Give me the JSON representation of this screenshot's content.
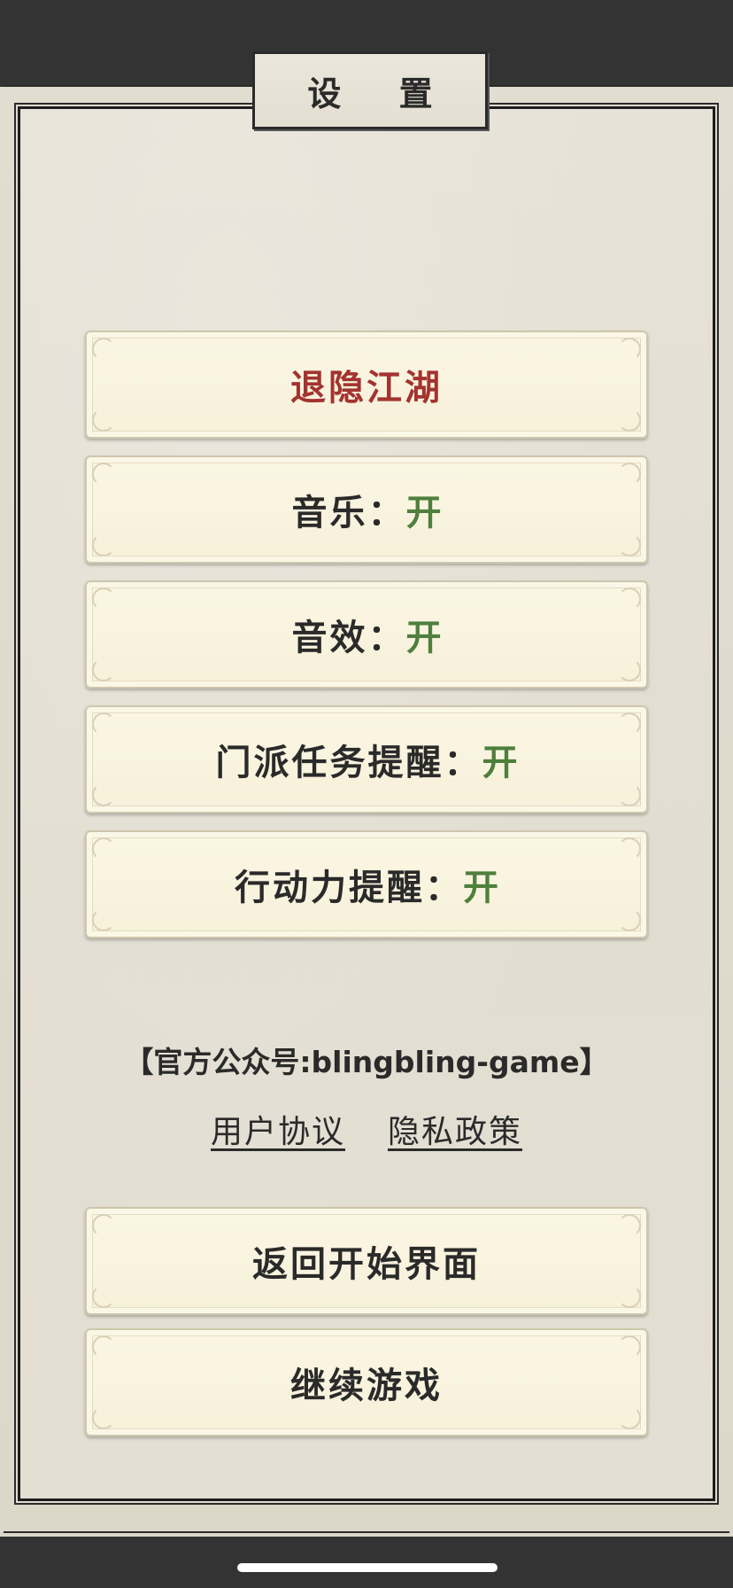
{
  "title": "设 置",
  "menu": {
    "retire": {
      "label": "退隐江湖",
      "color": "#a3332f"
    },
    "music": {
      "label": "音乐：",
      "value": "开"
    },
    "sfx": {
      "label": "音效：",
      "value": "开"
    },
    "sect_task": {
      "label": "门派任务提醒：",
      "value": "开"
    },
    "stamina": {
      "label": "行动力提醒：",
      "value": "开"
    }
  },
  "official_account": "【官方公众号:blingbling-game】",
  "links": {
    "user_agreement": "用户协议",
    "privacy_policy": "隐私政策"
  },
  "bottom": {
    "back_to_start": "返回开始界面",
    "continue_game": "继续游戏"
  },
  "colors": {
    "toggle_on": "#4f7f3d",
    "danger": "#a3332f",
    "button_bg": "#f9f4df"
  }
}
